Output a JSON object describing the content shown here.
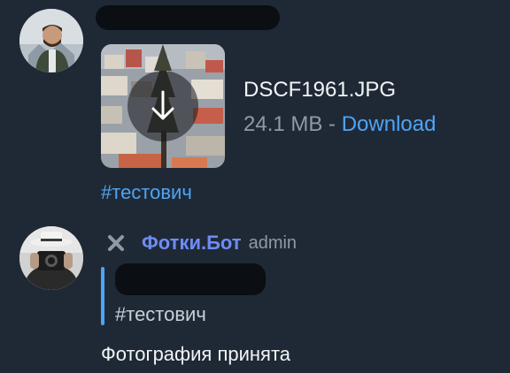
{
  "message_1": {
    "file": {
      "name": "DSCF1961.JPG",
      "size": "24.1 MB",
      "separator": " - ",
      "download_label": "Download"
    },
    "hashtag": "#тестович"
  },
  "message_2": {
    "sender_name": "Фотки.Бот",
    "sender_role": "admin",
    "quote_text": "#тестович",
    "text": "Фотография принята"
  },
  "icons": {
    "download": "arrow-down-icon",
    "bot_marker": "x-icon"
  },
  "colors": {
    "background": "#1f2936",
    "link": "#4ea4f6",
    "sender": "#6f8cf5",
    "muted": "#8f9aa6"
  }
}
